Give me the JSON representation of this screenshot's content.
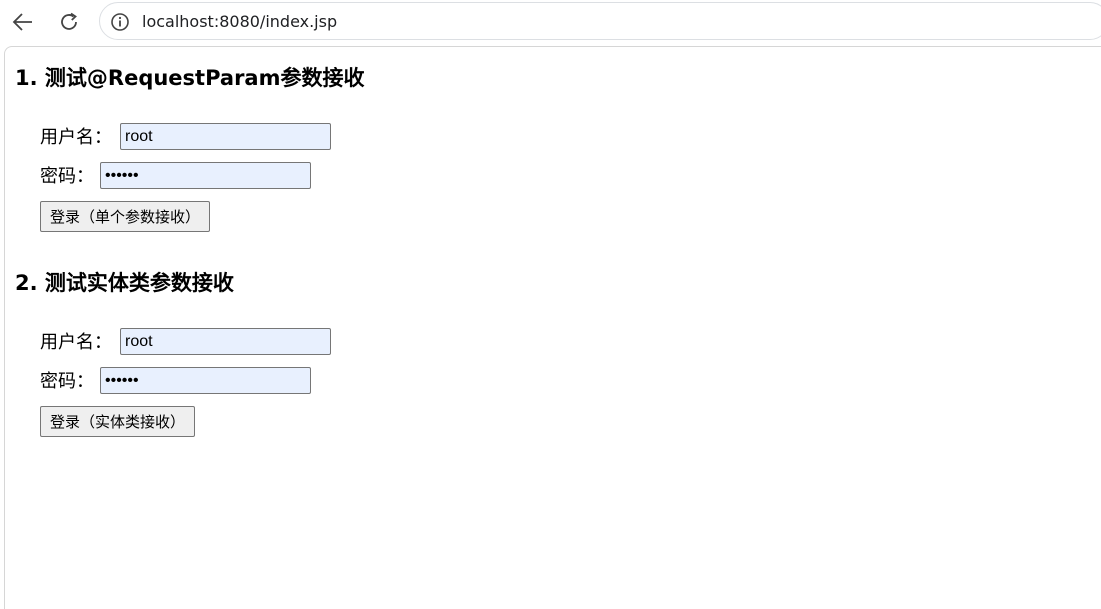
{
  "browser": {
    "url": "localhost:8080/index.jsp"
  },
  "section1": {
    "title": "1. 测试@RequestParam参数接收",
    "username_label": "用户名：",
    "username_value": "root",
    "password_label": "密码：",
    "password_value": "123456",
    "submit_label": "登录（单个参数接收）"
  },
  "section2": {
    "title": "2. 测试实体类参数接收",
    "username_label": "用户名：",
    "username_value": "root",
    "password_label": "密码：",
    "password_value": "123456",
    "submit_label": "登录（实体类接收）"
  },
  "icons": {
    "back": "arrow-left-icon",
    "reload": "reload-icon",
    "info": "info-icon"
  },
  "colors": {
    "autofill_bg": "#e8f0fe",
    "button_bg": "#efefef"
  }
}
